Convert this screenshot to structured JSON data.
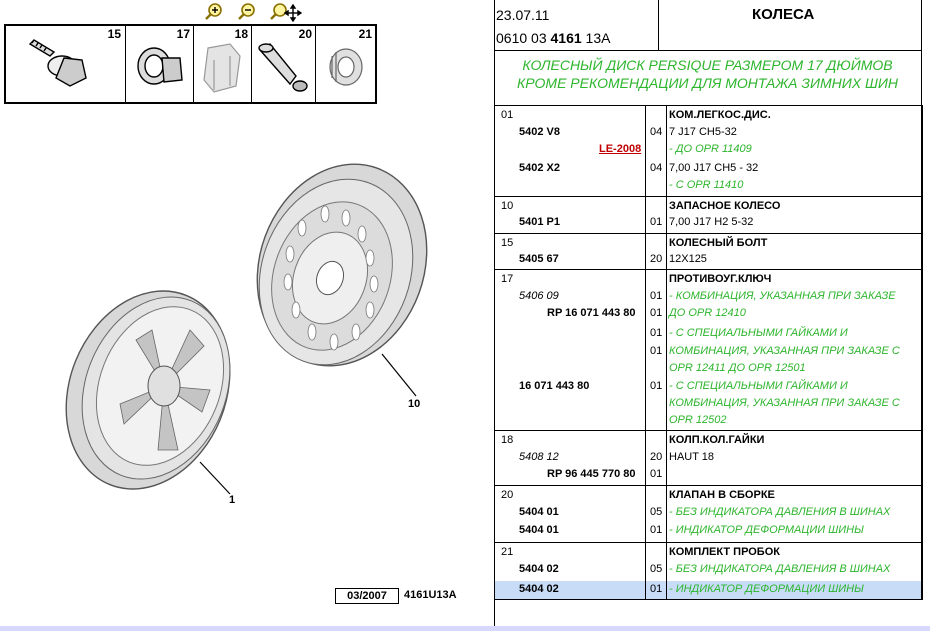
{
  "toolbar": {
    "zoom_in_icon": "zoom-in-icon",
    "zoom_out_icon": "zoom-out-icon",
    "move_icon": "zoom-move-icon"
  },
  "thumbnails": [
    {
      "num": "15",
      "icon": "wheel-bolt-icon"
    },
    {
      "num": "17",
      "icon": "anti-theft-key-icon"
    },
    {
      "num": "18",
      "icon": "nut-cap-icon"
    },
    {
      "num": "20",
      "icon": "valve-icon"
    },
    {
      "num": "21",
      "icon": "plug-kit-icon"
    }
  ],
  "callouts": {
    "c1": "1",
    "c10": "10"
  },
  "footer": {
    "date": "03/2007",
    "code": "4161U13A"
  },
  "header": {
    "date": "23.07.11",
    "ref_pre": "0610 03 ",
    "ref_bold": "4161",
    "ref_post": " 13A",
    "title": "КОЛЕСА"
  },
  "subtitle": {
    "line1": "КОЛЕСНЫЙ ДИСК PERSIQUE РАЗМЕРОМ 17 ДЮЙМОВ",
    "line2": "КРОМЕ РЕКОМЕНДАЦИИ ДЛЯ МОНТАЖА ЗИМНИХ ШИН"
  },
  "table": {
    "g01": {
      "num": "01",
      "name": "КОМ.ЛЕГКОС.ДИС.",
      "p1": "5402 V8",
      "q1": "04",
      "d1": "7 J17 CH5-32",
      "n1": "- ДО OPR 11409",
      "link": "LE-2008",
      "p2": "5402 X2",
      "q2": "04",
      "d2": "7,00 J17 CH5 - 32",
      "n2": "- С OPR 11410"
    },
    "g10": {
      "num": "10",
      "name": "ЗАПАСНОЕ КОЛЕСО",
      "p1": "5401 P1",
      "q1": "01",
      "d1": "7,00 J17 H2 5-32"
    },
    "g15": {
      "num": "15",
      "name": "КОЛЕСНЫЙ БОЛТ",
      "p1": "5405 67",
      "q1": "20",
      "d1": "12X125"
    },
    "g17": {
      "num": "17",
      "name": "ПРОТИВОУГ.КЛЮЧ",
      "p1": "5406 09",
      "q1": "01",
      "n1a": "- КОМБИНАЦИЯ, УКАЗАННАЯ ПРИ ЗАКАЗЕ",
      "n1b": "ДО OPR 12410",
      "p2": "RP 16 071 443 80",
      "q2": "01",
      "q3": "01",
      "n2a": "- С СПЕЦИАЛЬНЫМИ ГАЙКАМИ И",
      "q4": "01",
      "n2b": "КОМБИНАЦИЯ, УКАЗАННАЯ ПРИ ЗАКАЗЕ С",
      "n2c": "OPR 12411 ДО OPR 12501",
      "p3": "16 071 443 80",
      "q5": "01",
      "n3a": "- С СПЕЦИАЛЬНЫМИ ГАЙКАМИ И",
      "n3b": "КОМБИНАЦИЯ, УКАЗАННАЯ ПРИ ЗАКАЗЕ С",
      "n3c": "OPR 12502"
    },
    "g18": {
      "num": "18",
      "name": "КОЛП.КОЛ.ГАЙКИ",
      "p1": "5408 12",
      "q1": "20",
      "d1": "HAUT 18",
      "p2": "RP 96 445 770 80",
      "q2": "01"
    },
    "g20": {
      "num": "20",
      "name": "КЛАПАН В СБОРКЕ",
      "p1": "5404 01",
      "q1": "05",
      "n1": "- БЕЗ ИНДИКАТОРА ДАВЛЕНИЯ В ШИНАХ",
      "p2": "5404 01",
      "q2": "01",
      "n2": "- ИНДИКАТОР ДЕФОРМАЦИИ ШИНЫ"
    },
    "g21": {
      "num": "21",
      "name": "КОМПЛЕКТ ПРОБОК",
      "p1": "5404 02",
      "q1": "05",
      "n1": "- БЕЗ ИНДИКАТОРА ДАВЛЕНИЯ В ШИНАХ",
      "p2": "5404 02",
      "q2": "01",
      "n2": "- ИНДИКАТОР ДЕФОРМАЦИИ ШИНЫ"
    }
  },
  "colors": {
    "note_green": "#2db52d",
    "link_red": "#c00000",
    "highlight": "#c8dcf8"
  }
}
